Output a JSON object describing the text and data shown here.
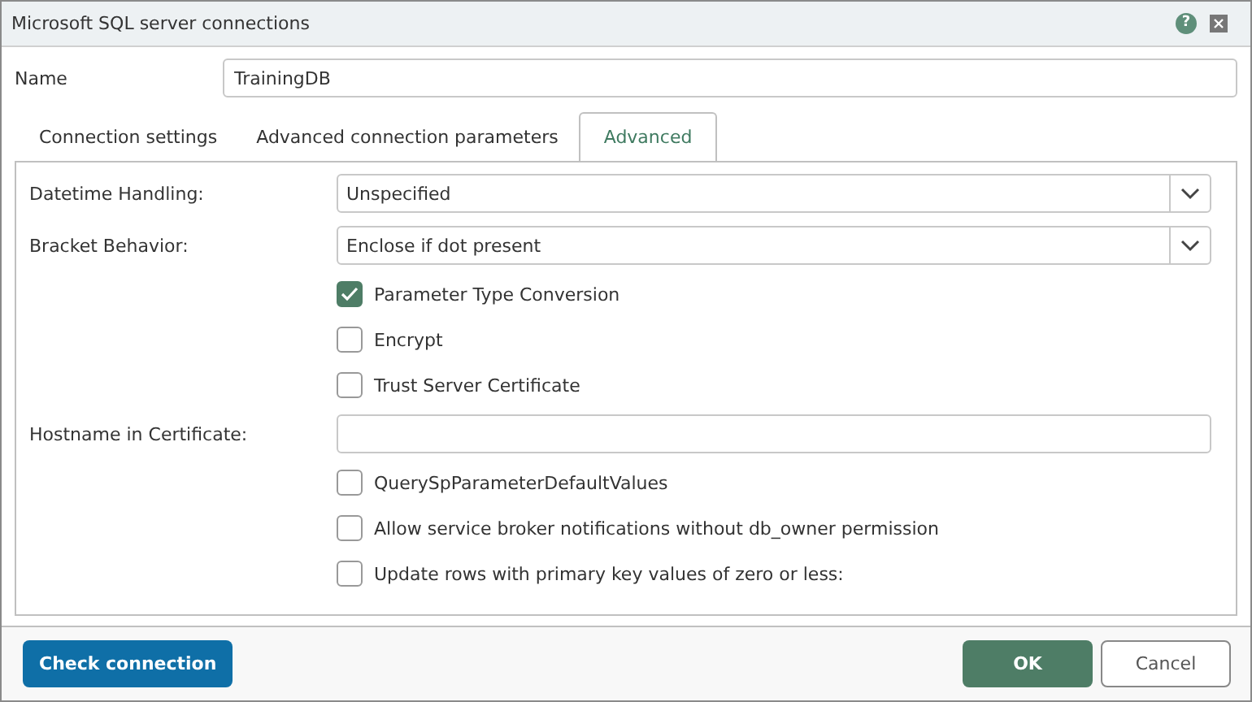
{
  "window": {
    "title": "Microsoft SQL server connections",
    "help": "?"
  },
  "name_field": {
    "label": "Name",
    "value": "TrainingDB"
  },
  "tabs": [
    {
      "label": "Connection settings",
      "selected": false
    },
    {
      "label": "Advanced connection parameters",
      "selected": false
    },
    {
      "label": "Advanced",
      "selected": true
    }
  ],
  "rows": [
    {
      "kind": "select",
      "label": "Datetime Handling:",
      "value": "Unspecified"
    },
    {
      "kind": "select",
      "label": "Bracket Behavior:",
      "value": "Enclose if dot present"
    },
    {
      "kind": "checkbox",
      "label": "Parameter Type Conversion",
      "checked": true
    },
    {
      "kind": "checkbox",
      "label": "Encrypt",
      "checked": false
    },
    {
      "kind": "checkbox",
      "label": "Trust Server Certificate",
      "checked": false
    },
    {
      "kind": "text",
      "label": "Hostname in Certificate:"
    },
    {
      "kind": "checkbox",
      "label": "QuerySpParameterDefaultValues",
      "checked": false
    },
    {
      "kind": "checkbox",
      "label": "Allow service broker notifications without db_owner permission",
      "checked": false
    },
    {
      "kind": "checkbox",
      "label": "Update rows with primary key values of zero or less:",
      "checked": false
    }
  ],
  "buttons": {
    "check": "Check connection",
    "ok": "OK",
    "cancel": "Cancel"
  }
}
